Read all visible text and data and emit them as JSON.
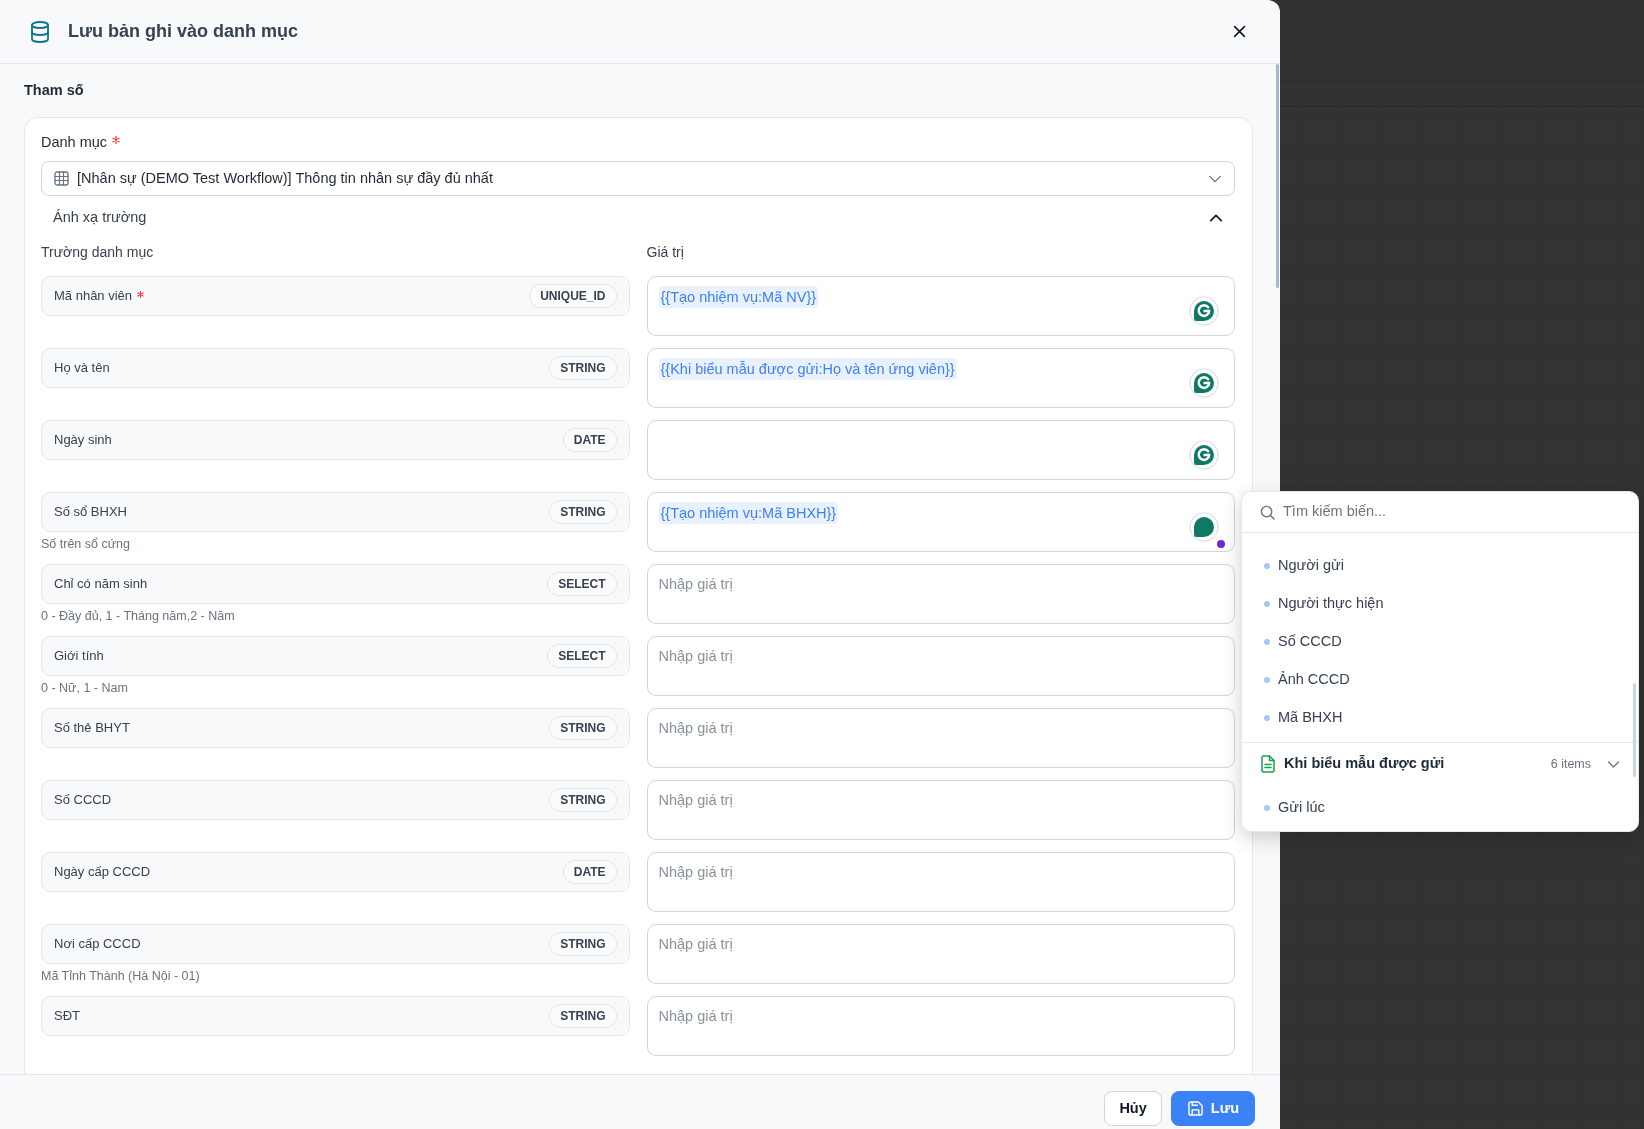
{
  "dialog": {
    "title": "Lưu bản ghi vào danh mục"
  },
  "section_title": "Tham số",
  "catalog": {
    "label": "Danh mục",
    "required": true,
    "value": "[Nhân sự (DEMO Test Workflow)] Thông tin nhân sự đầy đủ nhất"
  },
  "mapping": {
    "title": "Ánh xạ trường",
    "expanded": true,
    "columns": [
      "Trường danh mục",
      "Giá trị"
    ],
    "rows": [
      {
        "field": "Mã nhân viên",
        "required": true,
        "type": "UNIQUE_ID",
        "value": "{{Tạo nhiệm vụ:Mã NV}}",
        "assistant": true,
        "assistant_busy": false
      },
      {
        "field": "Họ và tên",
        "required": false,
        "type": "STRING",
        "value": "{{Khi biểu mẫu được gửi:Họ và tên ứng viên}}",
        "assistant": true,
        "assistant_busy": false
      },
      {
        "field": "Ngày sinh",
        "required": false,
        "type": "DATE",
        "assistant": true,
        "assistant_busy": false
      },
      {
        "field": "Số sổ BHXH",
        "required": false,
        "type": "STRING",
        "hint": "Số trên sổ cứng",
        "value": "{{Tạo nhiệm vụ:Mã BHXH}}",
        "assistant": true,
        "assistant_busy": true
      },
      {
        "field": "Chỉ có năm sinh",
        "required": false,
        "type": "SELECT",
        "hint": "0 - Đầy đủ, 1 - Tháng năm,2 - Năm",
        "placeholder": "Nhập giá trị",
        "assistant": false
      },
      {
        "field": "Giới tính",
        "required": false,
        "type": "SELECT",
        "hint": "0 - Nữ, 1 - Nam",
        "placeholder": "Nhập giá trị",
        "assistant": false
      },
      {
        "field": "Số thẻ BHYT",
        "required": false,
        "type": "STRING",
        "placeholder": "Nhập giá trị",
        "assistant": false
      },
      {
        "field": "Số CCCD",
        "required": false,
        "type": "STRING",
        "placeholder": "Nhập giá trị",
        "assistant": false
      },
      {
        "field": "Ngày cấp CCCD",
        "required": false,
        "type": "DATE",
        "placeholder": "Nhập giá trị",
        "assistant": false
      },
      {
        "field": "Nơi cấp CCCD",
        "required": false,
        "type": "STRING",
        "hint": "Mã Tỉnh Thành (Hà Nội - 01)",
        "placeholder": "Nhập giá trị",
        "assistant": false
      },
      {
        "field": "SĐT",
        "required": false,
        "type": "STRING",
        "placeholder": "Nhập giá trị",
        "assistant": false
      }
    ]
  },
  "variable_picker": {
    "search": {
      "placeholder": "Tìm kiếm biến..."
    },
    "groups": [
      {
        "items": [
          {
            "label": "Người gửi"
          },
          {
            "label": "Người thực hiện"
          },
          {
            "label": "Số CCCD"
          },
          {
            "label": "Ảnh CCCD"
          },
          {
            "label": "Mã BHXH"
          }
        ]
      },
      {
        "title": "Khi biểu mẫu được gửi",
        "count": "6 items",
        "expanded": true,
        "items": [
          {
            "label": "Gửi lúc"
          }
        ]
      }
    ]
  },
  "footer": {
    "buttons": [
      {
        "label": "Hủy",
        "kind": "secondary"
      },
      {
        "label": "Lưu",
        "kind": "primary"
      }
    ]
  }
}
